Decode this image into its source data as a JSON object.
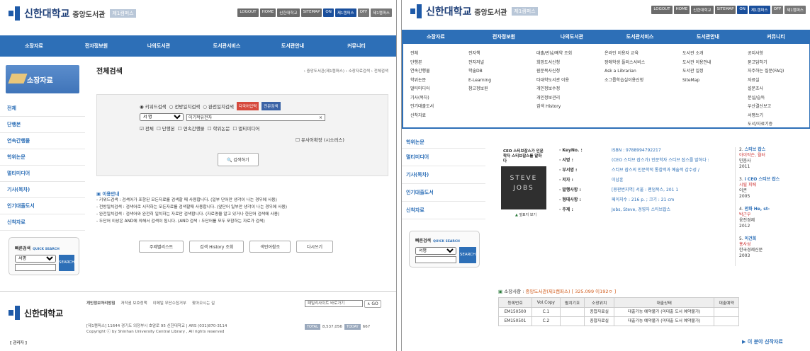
{
  "left": {
    "logo": {
      "name": "신한대학교",
      "library": "중앙도서관",
      "eng": "SHINHAN UNIVERSITY",
      "lib_eng": "LIBRARY",
      "campus": "제1캠퍼스"
    },
    "util": [
      "LOGOUT",
      "HOME",
      "신한대학교",
      "SITEMAP"
    ],
    "toggle": {
      "on": "ON",
      "campus": "제1캠퍼스",
      "off": "OFF",
      "campus2": "제1캠퍼스"
    },
    "nav": [
      "소장자료",
      "전자정보원",
      "나의도서관",
      "도서관서비스",
      "도서관안내",
      "커뮤니티"
    ],
    "side_title": "소장자료",
    "side_items": [
      "전체",
      "단행본",
      "연속간행물",
      "학위논문",
      "멀티미디어",
      "기사(목차)",
      "인기대출도서",
      "신착자료"
    ],
    "page_title": "전체검색",
    "breadcrumb": "› 중앙도서관(제1캠퍼스) › 소장자료검색 › 전체검색",
    "search": {
      "modes": [
        "키워드검색",
        "전방일치검색",
        "완전일치검색"
      ],
      "btn_multi": "다국어입력",
      "btn_special": "전문검색",
      "field": "서 명",
      "query": "이기적유전자",
      "clear": "×",
      "types": [
        "전체",
        "단행본",
        "연속간행물",
        "학위논문",
        "멀티미디어"
      ],
      "thesaurus": "유사어확장 (시소러스)",
      "submit": "검색하기"
    },
    "guide": {
      "title": "이용안내",
      "lines": [
        "- 키워드검색 : 검색어가 포함된 모든자료를 검색할 때 사용합니다. (일부 단어만 생각이 나는 경우에 사용)",
        "- 전방일치검색 : 검색어로 시작하는 모든자료를 검색할때 사용합니다. (앞단어 일부만 생각이 나는 경우에 사용)",
        "- 완전일치검색 : 검색어와 완전히 일치하는 자료만 검색합니다. (자료명을 알고 있거나 한단어 검색에 사용)",
        "- 두단어 이상은 AND에 의해서 검색이 됩니다. (AND 검색 : 두단어를 모두 포함하는 자료가 검색)"
      ]
    },
    "buttons": [
      "주제별리스트",
      "검색 History 조회",
      "색인어참조",
      "다시쓰기"
    ],
    "quick": {
      "title": "빠른검색",
      "sub": "QUICK SEARCH",
      "field": "서명",
      "btn": "SEARCH"
    },
    "footer": {
      "links": [
        "개인정보처리방침",
        "저작권 보호정책",
        "이메일 무단수집거부",
        "찾아오시는 길"
      ],
      "addr": "[제1캠퍼스] 11644 경기도 의정부시 호암로 95 신한대학교 | ARS (031)870-3114",
      "copy": "Copyright ⓒ by Shinhan University Central Library , All rights reserved",
      "family": "패밀리사이트 바로가기",
      "go": "GO",
      "total_label": "TOTAL",
      "total": "8,537,056",
      "today_label": "TODAY",
      "today": "667",
      "admin": "[ 관리자 ]",
      "logo": "신한대학교"
    }
  },
  "right": {
    "logo": {
      "name": "신한대학교",
      "library": "중앙도서관",
      "eng": "SHINHAN UNIVERSITY",
      "lib_eng": "LIBRARY",
      "campus": "제1캠퍼스"
    },
    "util": [
      "LOGOUT",
      "HOME",
      "신한대학교",
      "SITEMAP"
    ],
    "toggle": {
      "on": "ON",
      "campus": "제1캠퍼스",
      "off": "OFF",
      "campus2": "제1캠퍼스"
    },
    "nav": [
      "소장자료",
      "전자정보원",
      "나의도서관",
      "도서관서비스",
      "도서관안내",
      "커뮤니티"
    ],
    "dropdown": [
      [
        "전체",
        "단행본",
        "연속간행물",
        "학위논문",
        "멀티미디어",
        "기사(목차)",
        "인기대출도서",
        "신착자료"
      ],
      [
        "전자책",
        "전자저널",
        "학술DB",
        "E-Learning",
        "참고정보원"
      ],
      [
        "대출/반납/예약 조회",
        "희망도서신청",
        "원문복사신청",
        "타대학도서관 이용",
        "개인정보수정",
        "개인정보관리",
        "검색 History"
      ],
      [
        "온라인 이용자 교육",
        "장애학생 플러스서비스",
        "Ask a Librarian",
        "소그룹학습실이용신청"
      ],
      [
        "도서관 소개",
        "도서관 이용안내",
        "도서관 일정",
        "SiteMap"
      ],
      [
        "공지사항",
        "묻고답하기",
        "자주하는 질문(FAQ)",
        "자료실",
        "설문조사",
        "분실/습득",
        "우산결산보고",
        "서평쓰기",
        "도서/자료기증"
      ]
    ],
    "side_items": [
      "학위논문",
      "멀티미디어",
      "기사(목차)",
      "인기대출도서",
      "신착자료"
    ],
    "cover": {
      "title": "CEO 스티브잡스가 인문학자 스티브잡스를 말하다",
      "big": "STEVE JOBS",
      "preview": "앞표지 보기"
    },
    "meta": [
      {
        "k": "KeyNo.",
        "v": "ISBN : 9788994792217"
      },
      {
        "k": "서명",
        "v": "(CEO 스티브 잡스가) 인문학자 스티브 잡스를 말하다 :"
      },
      {
        "k": "부서명",
        "v": "스티브 잡스의 인문학적 통찰력과 예술적 감수성 /"
      },
      {
        "k": "저자",
        "v": "이남훈"
      },
      {
        "k": "발행사항",
        "v": "[용판번지역] 서울 : 팬덤북스, 201 1"
      },
      {
        "k": "형태사항",
        "v": "페이지수 : 216 p. ; 크기 : 21 cm"
      },
      {
        "k": "주제",
        "v": "Jobs, Steve, 경영자 스티브잡스"
      }
    ],
    "holdings": {
      "title": "소장사항",
      "location": "중앙도서관(제1캠퍼스)",
      "callno": "[ 325.099 이192ㅇ ]",
      "headers": [
        "등록번호",
        "Vol.Copy",
        "별치기호",
        "소장위치",
        "대출상태",
        "대출예약"
      ],
      "rows": [
        [
          "EM150500",
          "C.1",
          "",
          "종합자료실",
          "대출가능 예약불가 (미대출 도서 예약불가)",
          ""
        ],
        [
          "EM150501",
          "C.2",
          "",
          "종합자료실",
          "대출가능 예약불가 (미대출 도서 예약불가)",
          ""
        ]
      ]
    },
    "quick": {
      "title": "빠른검색",
      "sub": "QUICK SEARCH",
      "field": "서명",
      "btn": "SEARCH"
    },
    "popular": [
      {
        "n": "2.",
        "t": "스티브 잡스",
        "a": "아이작슨, 월터",
        "p": "민음사",
        "y": "2011"
      },
      {
        "n": "3.",
        "t": "i CEO 스티브 잡스",
        "a": "시릴 피베",
        "p": "이콘",
        "y": "2005"
      },
      {
        "n": "4.",
        "t": "만화 He, st-",
        "a": "박근우",
        "p": "웅진경제",
        "y": "2012"
      },
      {
        "n": "5.",
        "t": "이건희",
        "a": "홍사성",
        "p": "한국경제신문",
        "y": "2003"
      }
    ],
    "related": "이 분야 신작자료"
  }
}
